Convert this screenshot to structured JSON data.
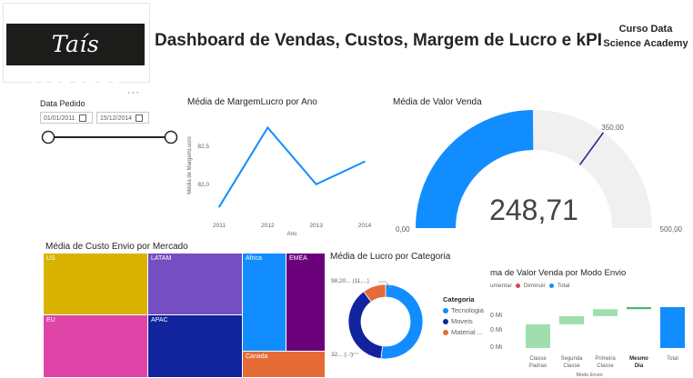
{
  "logo": {
    "text": "Taís Defante"
  },
  "header": {
    "title": "Dashboard de Vendas, Custos, Margem de Lucro e kPI",
    "org_line1": "Curso Data",
    "org_line2": "Science Academy"
  },
  "slicer": {
    "title": "Data Pedido",
    "start_date": "01/01/2011",
    "end_date": "15/12/2014",
    "more_label": "···"
  },
  "line_chart": {
    "title": "Média de MargemLucro por Ano",
    "ylabel": "Média de MargemLucro",
    "xlabel": "Ano",
    "ytick_labels": [
      "82,0",
      "82,5"
    ],
    "xtick_labels": [
      "2011",
      "2012",
      "2013",
      "2014"
    ]
  },
  "gauge": {
    "title": "Média de Valor Venda",
    "value_label": "248,71",
    "min_label": "0,00",
    "max_label": "500,00",
    "target_label": "350,00",
    "colors": {
      "fill": "#118DFF",
      "track": "#F0F0F0",
      "target": "#1E1E8C"
    }
  },
  "treemap": {
    "title": "Média de Custo Envio por Mercado",
    "labels": [
      "US",
      "LATAM",
      "Africa",
      "EMEA",
      "EU",
      "APAC",
      "Canada"
    ],
    "colors": [
      "#D9B300",
      "#744EC2",
      "#118DFF",
      "#6B007B",
      "#E044A7",
      "#12239E",
      "#E66C37"
    ]
  },
  "donut": {
    "title": "Média de Lucro por Categoria",
    "legend_title": "Categoria",
    "legend_items": [
      "Tecnologia",
      "Moveis",
      "Material ..."
    ],
    "label_top": "98,20... (11,...)",
    "label_bottom": "32... (...)",
    "colors": [
      "#118DFF",
      "#12239E",
      "#E66C37"
    ]
  },
  "waterfall": {
    "title": "ma de Valor Venda por Modo Envio",
    "legend_items": [
      "umentar",
      "Diminuir",
      "Total"
    ],
    "legend_colors": [
      "#A0DEB0",
      "#D64550",
      "#118DFF"
    ],
    "ytick_labels": [
      "0 Mi",
      "0 Mi",
      "0 Mi"
    ],
    "categories": [
      "Classe\nPadrao",
      "Segunda\nClasse",
      "Primeira\nClasse",
      "Mesmo\nDia",
      "Total"
    ],
    "xlabel": "Modo Envio"
  },
  "chart_data": [
    {
      "type": "line",
      "title": "Média de MargemLucro por Ano",
      "xlabel": "Ano",
      "ylabel": "Média de MargemLucro",
      "x": [
        2011,
        2012,
        2013,
        2014
      ],
      "series": [
        {
          "values": [
            81.7,
            82.75,
            82.0,
            82.3
          ]
        }
      ],
      "ylim": [
        81.6,
        82.9
      ],
      "grid": false
    },
    {
      "type": "gauge",
      "title": "Média de Valor Venda",
      "value": 248.71,
      "min": 0,
      "max": 500,
      "target": 350
    },
    {
      "type": "treemap",
      "title": "Média de Custo Envio por Mercado",
      "categories": [
        "US",
        "LATAM",
        "Africa",
        "EMEA",
        "EU",
        "APAC",
        "Canada"
      ]
    },
    {
      "type": "pie",
      "title": "Média de Lucro por Categoria",
      "categories": [
        "Tecnologia",
        "Moveis",
        "Material ..."
      ],
      "values": [
        52,
        38,
        10
      ],
      "legend": "right"
    },
    {
      "type": "bar",
      "title": "ma de Valor Venda por Modo Envio",
      "xlabel": "Modo Envio",
      "categories": [
        "Classe Padrao",
        "Segunda Classe",
        "Primeira Classe",
        "Mesmo Dia",
        "Total"
      ],
      "values": [
        0.58,
        0.2,
        0.17,
        0.05,
        1.0
      ],
      "ylim": [
        0,
        1.0
      ]
    }
  ]
}
